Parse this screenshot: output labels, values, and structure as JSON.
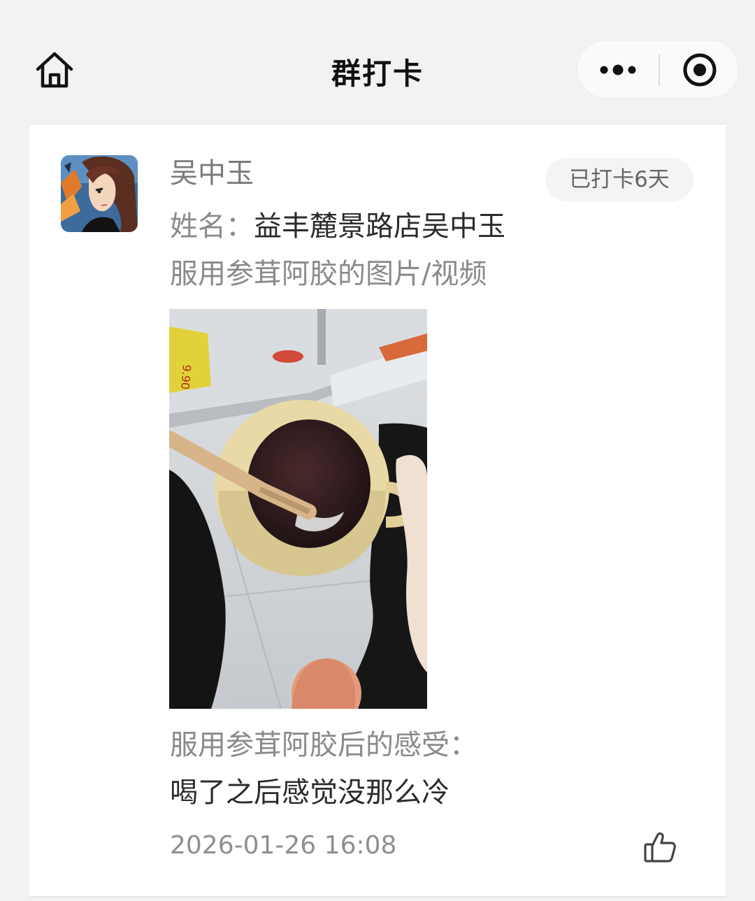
{
  "nav": {
    "title": "群打卡",
    "home_icon": "home-icon",
    "more_icon": "more-dots-icon",
    "close_icon": "mini-program-close-icon"
  },
  "post": {
    "author": "吴中玉",
    "badge": "已打卡6天",
    "name_label": "姓名：",
    "name_value": "益丰麓景路店吴中玉",
    "question_photo": "服用参茸阿胶的图片/视频",
    "photo_icon": "photo-cup-of-drink",
    "question_feeling": "服用参茸阿胶后的感受：",
    "answer_feeling": "喝了之后感觉没那么冷",
    "timestamp": "2026-01-26 16:08",
    "like_icon": "thumbs-up-icon"
  },
  "colors": {
    "background": "#f2f2f2",
    "card": "#ffffff",
    "muted_text": "#8a8a8a",
    "body_text": "#2b2b2b"
  }
}
